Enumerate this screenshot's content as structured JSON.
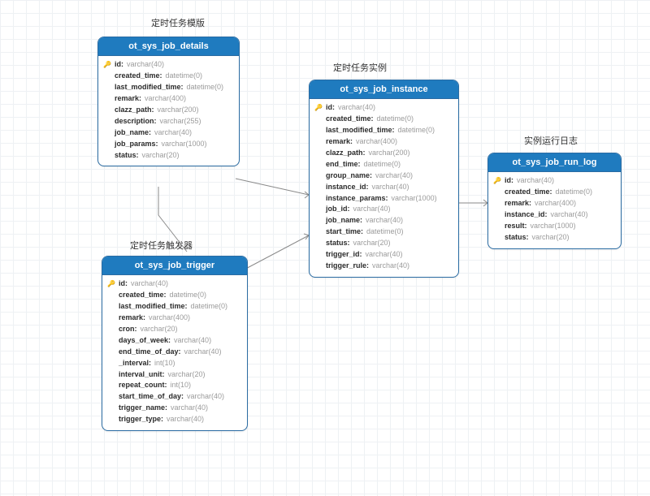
{
  "labels": {
    "details": "定时任务模版",
    "trigger": "定时任务触发器",
    "instance": "定时任务实例",
    "runlog": "实例运行日志"
  },
  "entities": {
    "details": {
      "name": "ot_sys_job_details",
      "cols": [
        {
          "pk": true,
          "name": "id",
          "type": "varchar(40)"
        },
        {
          "pk": false,
          "name": "created_time",
          "type": "datetime(0)"
        },
        {
          "pk": false,
          "name": "last_modified_time",
          "type": "datetime(0)"
        },
        {
          "pk": false,
          "name": "remark",
          "type": "varchar(400)"
        },
        {
          "pk": false,
          "name": "clazz_path",
          "type": "varchar(200)"
        },
        {
          "pk": false,
          "name": "description",
          "type": "varchar(255)"
        },
        {
          "pk": false,
          "name": "job_name",
          "type": "varchar(40)"
        },
        {
          "pk": false,
          "name": "job_params",
          "type": "varchar(1000)"
        },
        {
          "pk": false,
          "name": "status",
          "type": "varchar(20)"
        }
      ]
    },
    "trigger": {
      "name": "ot_sys_job_trigger",
      "cols": [
        {
          "pk": true,
          "name": "id",
          "type": "varchar(40)"
        },
        {
          "pk": false,
          "name": "created_time",
          "type": "datetime(0)"
        },
        {
          "pk": false,
          "name": "last_modified_time",
          "type": "datetime(0)"
        },
        {
          "pk": false,
          "name": "remark",
          "type": "varchar(400)"
        },
        {
          "pk": false,
          "name": "cron",
          "type": "varchar(20)"
        },
        {
          "pk": false,
          "name": "days_of_week",
          "type": "varchar(40)"
        },
        {
          "pk": false,
          "name": "end_time_of_day",
          "type": "varchar(40)"
        },
        {
          "pk": false,
          "name": "_interval",
          "type": "int(10)"
        },
        {
          "pk": false,
          "name": "interval_unit",
          "type": "varchar(20)"
        },
        {
          "pk": false,
          "name": "repeat_count",
          "type": "int(10)"
        },
        {
          "pk": false,
          "name": "start_time_of_day",
          "type": "varchar(40)"
        },
        {
          "pk": false,
          "name": "trigger_name",
          "type": "varchar(40)"
        },
        {
          "pk": false,
          "name": "trigger_type",
          "type": "varchar(40)"
        }
      ]
    },
    "instance": {
      "name": "ot_sys_job_instance",
      "cols": [
        {
          "pk": true,
          "name": "id",
          "type": "varchar(40)"
        },
        {
          "pk": false,
          "name": "created_time",
          "type": "datetime(0)"
        },
        {
          "pk": false,
          "name": "last_modified_time",
          "type": "datetime(0)"
        },
        {
          "pk": false,
          "name": "remark",
          "type": "varchar(400)"
        },
        {
          "pk": false,
          "name": "clazz_path",
          "type": "varchar(200)"
        },
        {
          "pk": false,
          "name": "end_time",
          "type": "datetime(0)"
        },
        {
          "pk": false,
          "name": "group_name",
          "type": "varchar(40)"
        },
        {
          "pk": false,
          "name": "instance_id",
          "type": "varchar(40)"
        },
        {
          "pk": false,
          "name": "instance_params",
          "type": "varchar(1000)"
        },
        {
          "pk": false,
          "name": "job_id",
          "type": "varchar(40)"
        },
        {
          "pk": false,
          "name": "job_name",
          "type": "varchar(40)"
        },
        {
          "pk": false,
          "name": "start_time",
          "type": "datetime(0)"
        },
        {
          "pk": false,
          "name": "status",
          "type": "varchar(20)"
        },
        {
          "pk": false,
          "name": "trigger_id",
          "type": "varchar(40)"
        },
        {
          "pk": false,
          "name": "trigger_rule",
          "type": "varchar(40)"
        }
      ]
    },
    "runlog": {
      "name": "ot_sys_job_run_log",
      "cols": [
        {
          "pk": true,
          "name": "id",
          "type": "varchar(40)"
        },
        {
          "pk": false,
          "name": "created_time",
          "type": "datetime(0)"
        },
        {
          "pk": false,
          "name": "remark",
          "type": "varchar(400)"
        },
        {
          "pk": false,
          "name": "instance_id",
          "type": "varchar(40)"
        },
        {
          "pk": false,
          "name": "result",
          "type": "varchar(1000)"
        },
        {
          "pk": false,
          "name": "status",
          "type": "varchar(20)"
        }
      ]
    }
  }
}
